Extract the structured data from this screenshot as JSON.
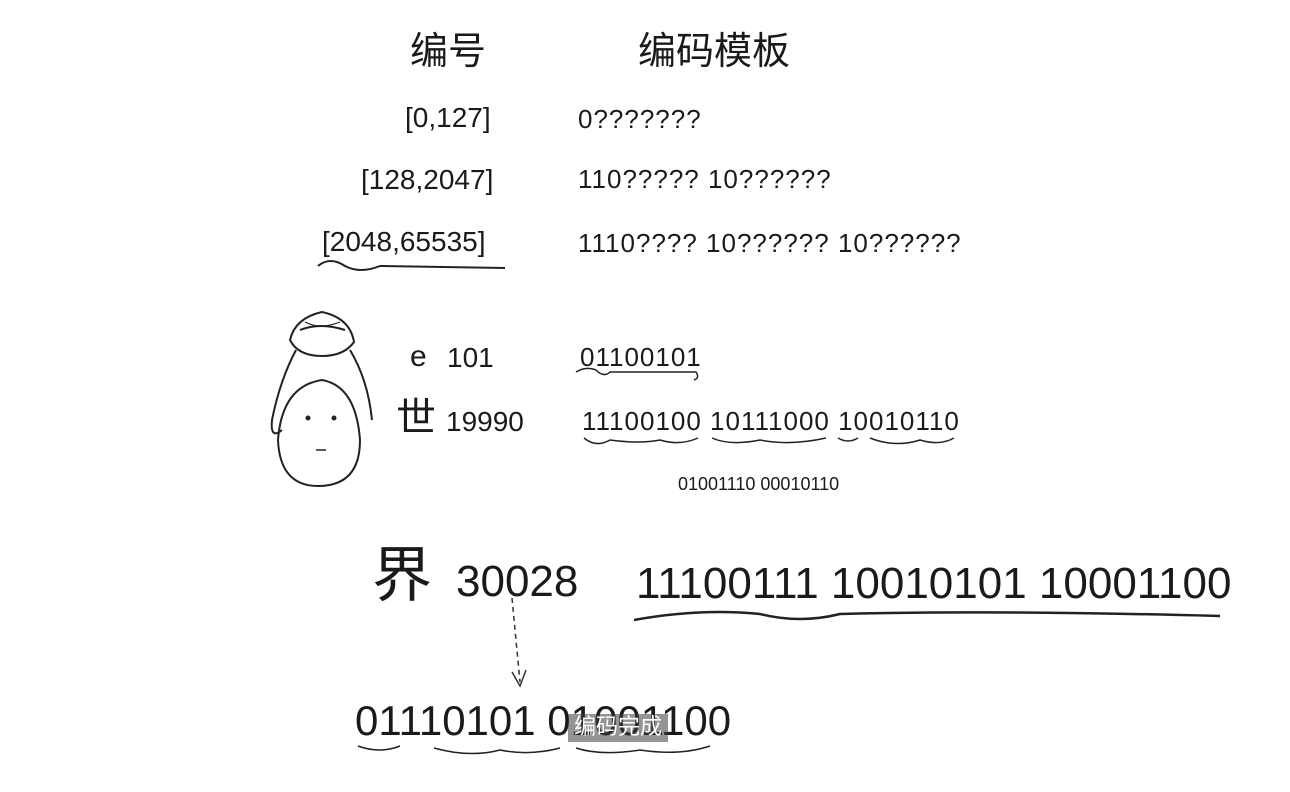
{
  "headers": {
    "number": "编号",
    "template": "编码模板"
  },
  "ranges": [
    {
      "range": "[0,127]",
      "template": "0???????"
    },
    {
      "range": "[128,2047]",
      "template": "110????? 10??????"
    },
    {
      "range": "[2048,65535]",
      "template": "1110???? 10?????? 10??????"
    }
  ],
  "examples": {
    "e": {
      "char": "e",
      "code": "101",
      "binary": "01100101"
    },
    "shi": {
      "char": "世",
      "code": "19990",
      "binary": "11100100  10111000  10010110",
      "raw": "01001110 00010110"
    },
    "jie": {
      "char": "界",
      "code": "30028",
      "binary": "11100111   10010101 10001100",
      "raw": "01110101 01001100"
    }
  },
  "subtitle": "编码完成"
}
